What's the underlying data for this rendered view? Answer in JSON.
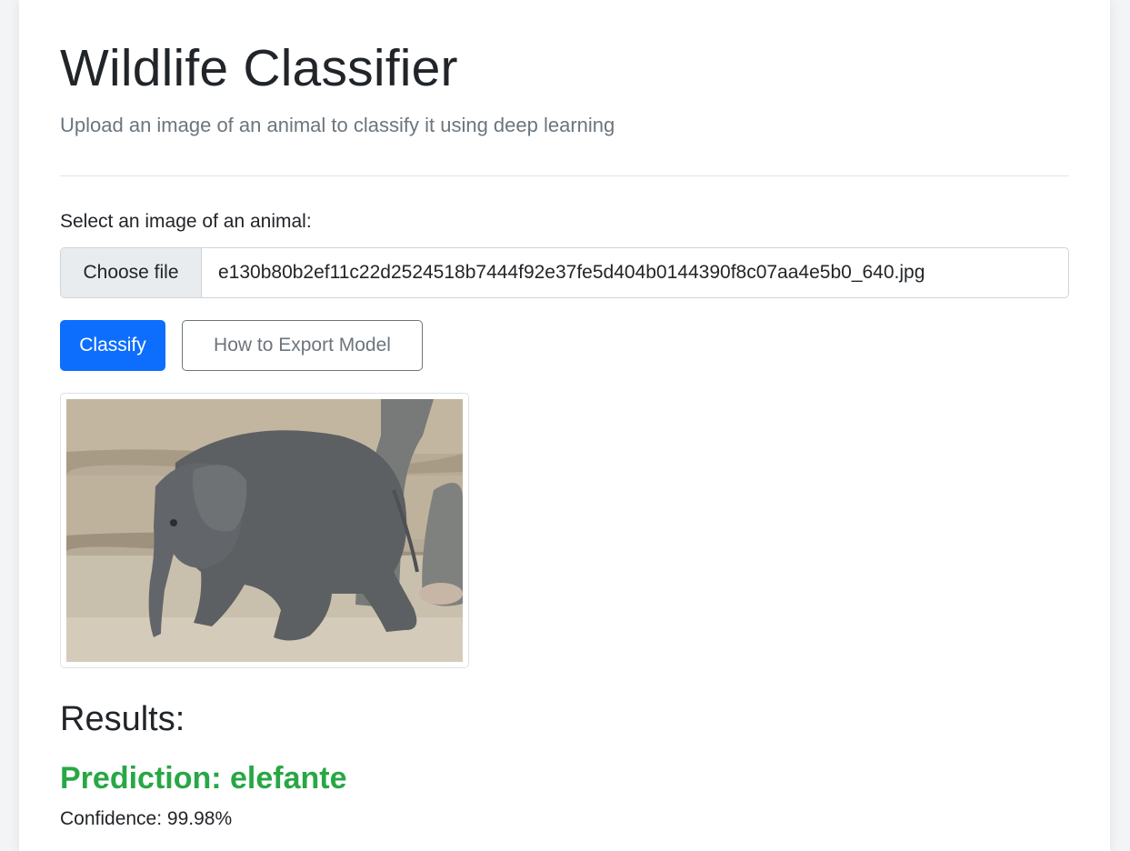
{
  "header": {
    "title": "Wildlife Classifier",
    "subtitle": "Upload an image of an animal to classify it using deep learning"
  },
  "upload": {
    "label": "Select an image of an animal:",
    "choose_file_label": "Choose file",
    "selected_file": "e130b80b2ef11c22d2524518b7444f92e37fe5d404b0144390f8c07aa4e5b0_640.jpg"
  },
  "actions": {
    "classify_label": "Classify",
    "export_label": "How to Export Model"
  },
  "preview": {
    "image_subject": "baby-elephant-photo"
  },
  "results": {
    "heading": "Results:",
    "prediction": "Prediction: elefante",
    "confidence": "Confidence: 99.98%"
  },
  "colors": {
    "primary": "#0d6efd",
    "success": "#28a745",
    "muted": "#6c757d"
  }
}
